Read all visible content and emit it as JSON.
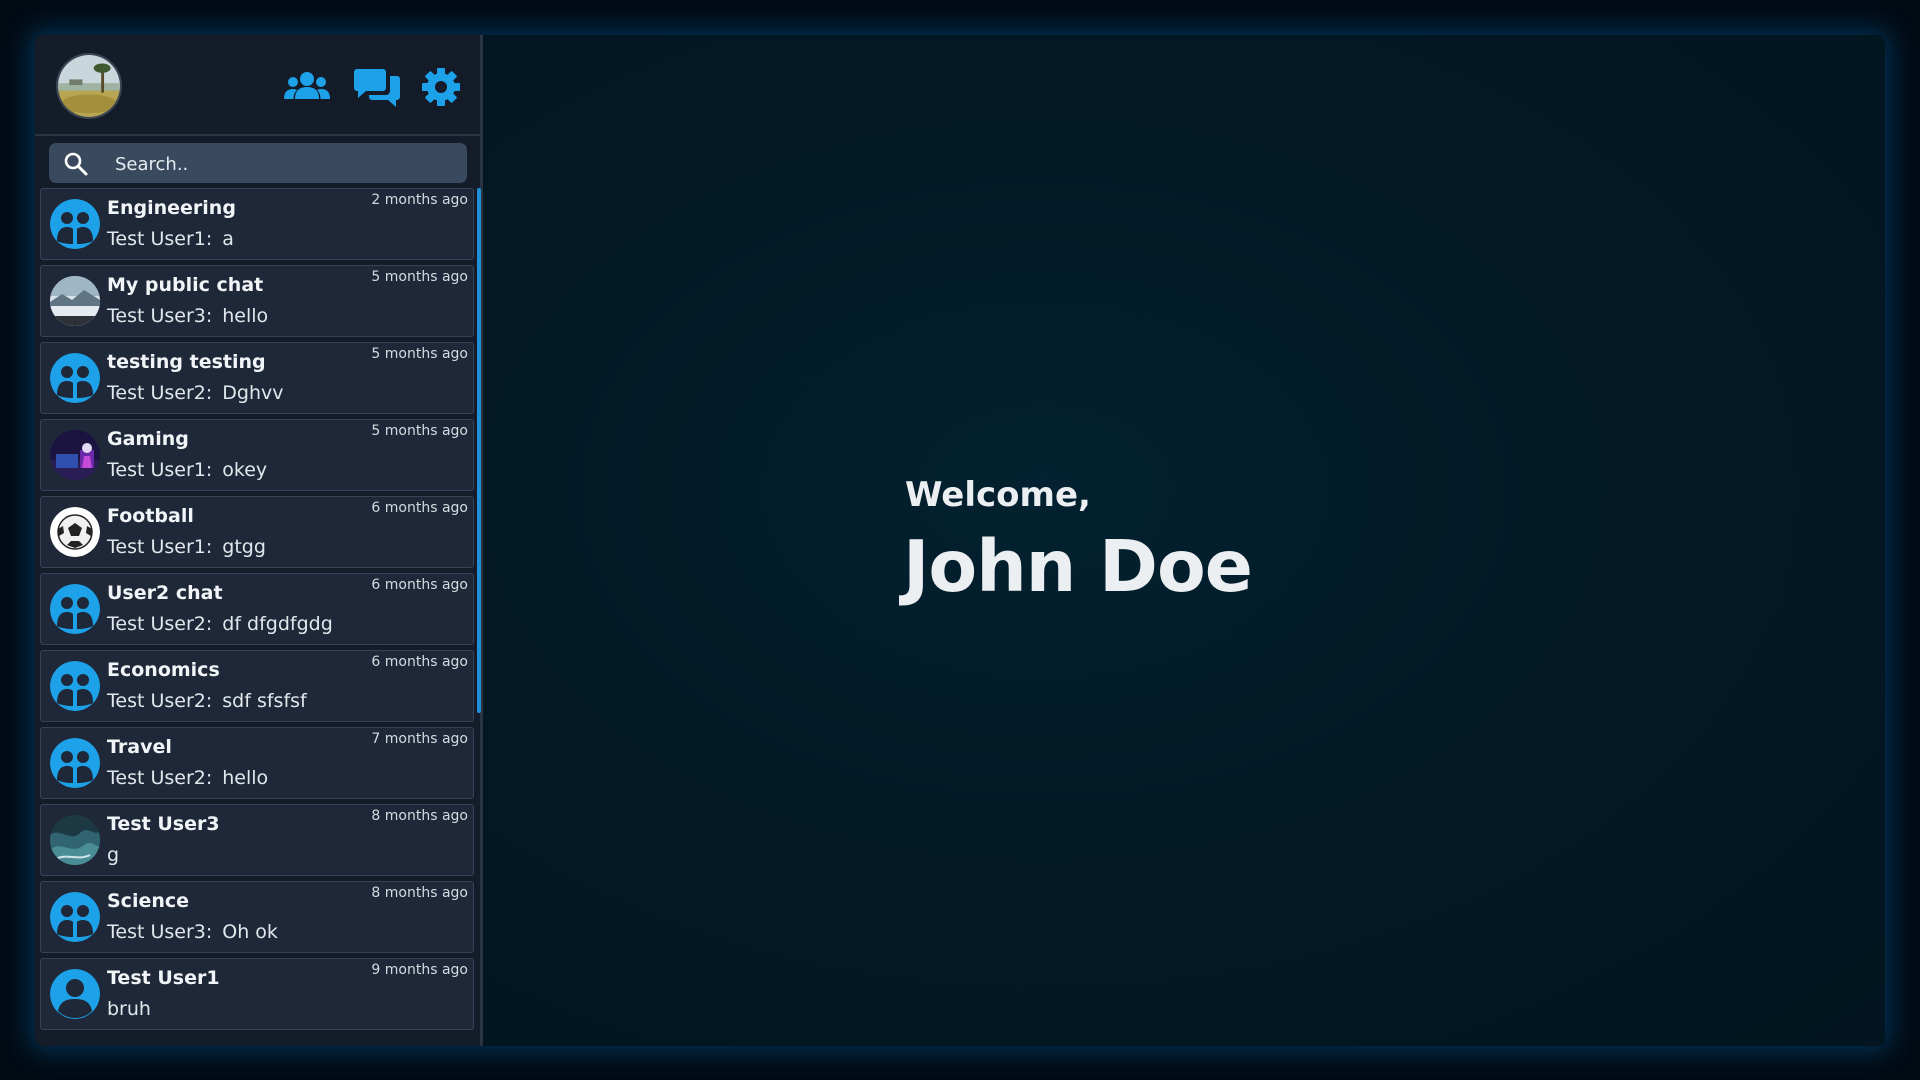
{
  "colors": {
    "accent": "#1da1e8",
    "sidebar_bg": "#141b29",
    "item_bg": "#1f2838",
    "main_bg": "#021520"
  },
  "header": {
    "icons": [
      "users-icon",
      "chat-icon",
      "gear-icon"
    ]
  },
  "search": {
    "placeholder": "Search.."
  },
  "chats": [
    {
      "name": "Engineering",
      "sender": "Test User1:",
      "message": "a",
      "time": "2 months ago",
      "avatar": "group-icon"
    },
    {
      "name": "My public chat",
      "sender": "Test User3:",
      "message": "hello",
      "time": "5 months ago",
      "avatar": "photo-landscape"
    },
    {
      "name": "testing testing",
      "sender": "Test User2:",
      "message": "Dghvv",
      "time": "5 months ago",
      "avatar": "group-icon"
    },
    {
      "name": "Gaming",
      "sender": "Test User1:",
      "message": "okey",
      "time": "5 months ago",
      "avatar": "photo-gaming"
    },
    {
      "name": "Football",
      "sender": "Test User1:",
      "message": "gtgg",
      "time": "6 months ago",
      "avatar": "photo-football"
    },
    {
      "name": "User2 chat",
      "sender": "Test User2:",
      "message": "df dfgdfgdg",
      "time": "6 months ago",
      "avatar": "group-icon"
    },
    {
      "name": "Economics",
      "sender": "Test User2:",
      "message": "sdf sfsfsf",
      "time": "6 months ago",
      "avatar": "group-icon"
    },
    {
      "name": "Travel",
      "sender": "Test User2:",
      "message": "hello",
      "time": "7 months ago",
      "avatar": "group-icon"
    },
    {
      "name": "Test User3",
      "sender": "",
      "message": "g",
      "time": "8 months ago",
      "avatar": "photo-ocean"
    },
    {
      "name": "Science",
      "sender": "Test User3:",
      "message": "Oh ok",
      "time": "8 months ago",
      "avatar": "group-icon"
    },
    {
      "name": "Test User1",
      "sender": "",
      "message": "bruh",
      "time": "9 months ago",
      "avatar": "person-icon"
    }
  ],
  "main": {
    "welcome": "Welcome,",
    "user_name": "John Doe"
  }
}
